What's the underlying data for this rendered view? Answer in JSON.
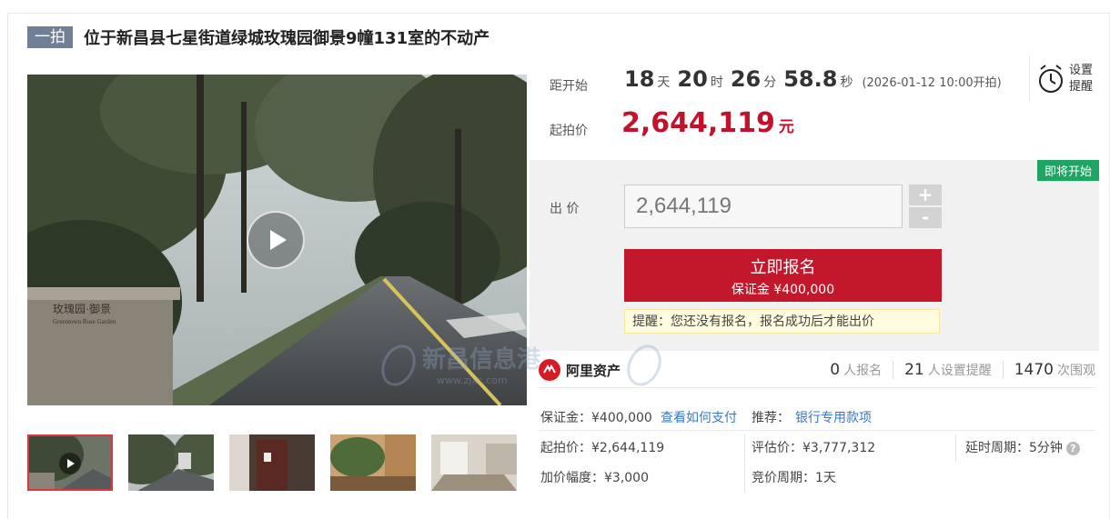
{
  "header": {
    "badge": "一拍",
    "title": "位于新昌县七星街道绿城玫瑰园御景9幢131室的不动产"
  },
  "gallery": {
    "sign_text": "玫瑰园·御景",
    "sign_text_en": "Greentown Rose Garden",
    "thumbnails": [
      "road-video",
      "road",
      "door",
      "garden",
      "room"
    ]
  },
  "countdown": {
    "label": "距开始",
    "days": "18",
    "days_unit": "天",
    "hours": "20",
    "hours_unit": "时",
    "minutes": "26",
    "minutes_unit": "分",
    "seconds": "58.8",
    "seconds_unit": "秒",
    "start_time": "(2026-01-12 10:00开拍)"
  },
  "reminder": {
    "line1": "设置",
    "line2": "提醒",
    "icon": "alarm-clock-icon"
  },
  "start_price": {
    "label": "起拍价",
    "value": "2,644,119",
    "unit": "元"
  },
  "bid": {
    "status_tag": "即将开始",
    "label": "出 价",
    "input_value": "2,644,119",
    "plus": "+",
    "minus": "-",
    "signup_main": "立即报名",
    "signup_sub": "保证金 ¥400,000",
    "tip": "提醒：您还没有报名，报名成功后才能出价"
  },
  "agency": {
    "name": "阿里资产"
  },
  "stats": [
    {
      "num": "0",
      "label": "人报名"
    },
    {
      "num": "21",
      "label": "人设置提醒"
    },
    {
      "num": "1470",
      "label": "次围观"
    }
  ],
  "info": {
    "deposit": "保证金：¥400,000",
    "how_to_pay": "查看如何支付",
    "recommend_label": "推荐：",
    "recommend_link": "银行专用款项",
    "start_price": "起拍价：¥2,644,119",
    "valuation": "评估价：¥3,777,312",
    "delay_period": "延时周期：5分钟",
    "increment": "加价幅度：¥3,000",
    "bidding_period": "竞价周期：1天"
  },
  "watermark": {
    "text": "新昌信息港",
    "url": "www.zjxc.com"
  },
  "colors": {
    "price_red": "#c3102b",
    "signup_red": "#c3182b",
    "status_green": "#1ea563",
    "link_blue": "#3a78c3",
    "badge_gray": "#707e96"
  }
}
